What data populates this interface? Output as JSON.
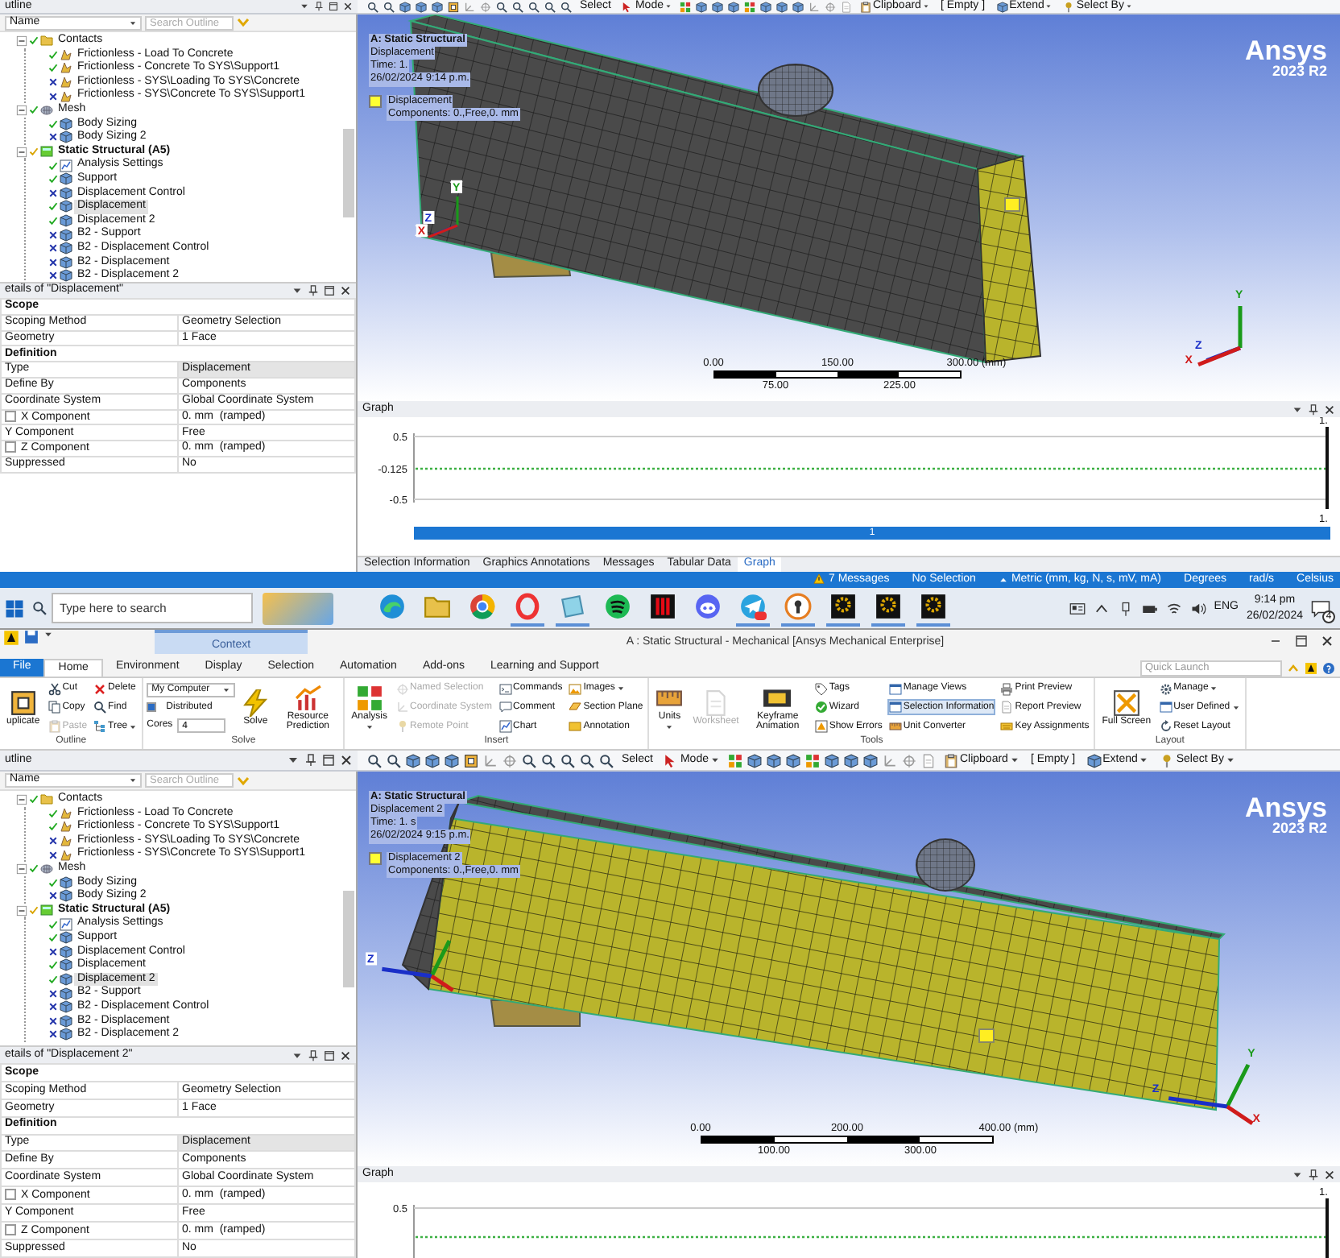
{
  "panes": [
    {
      "outline_title": "utline",
      "toolbar": [
        {
          "label": "Select",
          "kind": "button"
        },
        {
          "label": "Mode",
          "kind": "menu"
        },
        {
          "label": "Clipboard",
          "kind": "menu"
        },
        {
          "label": "[ Empty ]",
          "kind": "button"
        },
        {
          "label": "Extend",
          "kind": "menu"
        },
        {
          "label": "Select By",
          "kind": "menu"
        }
      ],
      "outline": {
        "name_filter": "Name",
        "search_placeholder": "Search Outline",
        "tree": [
          {
            "label": "Contacts",
            "kind": "folder",
            "solved": true,
            "suppressed": false,
            "selected": false,
            "expanded": true,
            "children": [
              {
                "label": "Frictionless - Load To Concrete",
                "kind": "contact",
                "solved": true,
                "suppressed": false,
                "selected": false
              },
              {
                "label": "Frictionless - Concrete To SYS\\Support1",
                "kind": "contact",
                "solved": true,
                "suppressed": false,
                "selected": false
              },
              {
                "label": "Frictionless - SYS\\Loading To SYS\\Concrete",
                "kind": "contact",
                "solved": false,
                "suppressed": true,
                "selected": false
              },
              {
                "label": "Frictionless - SYS\\Concrete To SYS\\Support1",
                "kind": "contact",
                "solved": false,
                "suppressed": true,
                "selected": false
              }
            ]
          },
          {
            "label": "Mesh",
            "kind": "mesh",
            "solved": true,
            "suppressed": false,
            "selected": false,
            "expanded": true,
            "children": [
              {
                "label": "Body Sizing",
                "kind": "sizing",
                "solved": true,
                "suppressed": false,
                "selected": false
              },
              {
                "label": "Body Sizing 2",
                "kind": "sizing",
                "solved": false,
                "suppressed": true,
                "selected": false
              }
            ]
          },
          {
            "label": "Static Structural (A5)",
            "kind": "environment",
            "solved": false,
            "suppressed": false,
            "selected": false,
            "expanded": true,
            "children": [
              {
                "label": "Analysis Settings",
                "kind": "settings",
                "solved": true,
                "suppressed": false,
                "selected": false
              },
              {
                "label": "Support",
                "kind": "boundary",
                "solved": true,
                "suppressed": false,
                "selected": false
              },
              {
                "label": "Displacement Control",
                "kind": "boundary",
                "solved": false,
                "suppressed": true,
                "selected": false
              },
              {
                "label": "Displacement",
                "kind": "boundary",
                "solved": true,
                "suppressed": false,
                "selected": true
              },
              {
                "label": "Displacement 2",
                "kind": "boundary",
                "solved": true,
                "suppressed": false,
                "selected": false
              },
              {
                "label": "B2 - Support",
                "kind": "boundary",
                "solved": false,
                "suppressed": true,
                "selected": false
              },
              {
                "label": "B2 - Displacement Control",
                "kind": "boundary",
                "solved": false,
                "suppressed": true,
                "selected": false
              },
              {
                "label": "B2 - Displacement",
                "kind": "boundary",
                "solved": false,
                "suppressed": true,
                "selected": false
              },
              {
                "label": "B2 - Displacement 2",
                "kind": "boundary",
                "solved": false,
                "suppressed": true,
                "selected": false
              }
            ]
          }
        ]
      },
      "details": {
        "title": "etails of \"Displacement\"",
        "rows": [
          {
            "kind": "section",
            "label": "Scope"
          },
          {
            "kind": "property",
            "label": "Scoping Method",
            "value": "Geometry Selection",
            "highlighted": false
          },
          {
            "kind": "property",
            "label": "Geometry",
            "value": "1 Face",
            "highlighted": false
          },
          {
            "kind": "section",
            "label": "Definition"
          },
          {
            "kind": "property",
            "label": "Type",
            "value": "Displacement",
            "highlighted": true
          },
          {
            "kind": "property",
            "label": "Define By",
            "value": "Components",
            "highlighted": false
          },
          {
            "kind": "property",
            "label": "Coordinate System",
            "value": "Global Coordinate System",
            "highlighted": false
          },
          {
            "kind": "check-property",
            "label": "X Component",
            "value": "0. mm  (ramped)",
            "checked": false,
            "highlighted": false
          },
          {
            "kind": "property",
            "label": "Y Component",
            "value": "Free",
            "highlighted": false
          },
          {
            "kind": "check-property",
            "label": "Z Component",
            "value": "0. mm  (ramped)",
            "checked": false,
            "highlighted": false
          },
          {
            "kind": "property",
            "label": "Suppressed",
            "value": "No",
            "highlighted": false
          }
        ]
      },
      "viewport": {
        "title": "A: Static Structural",
        "lines": [
          "Displacement",
          "Time: 1.",
          "26/02/2024 9:14 p.m."
        ],
        "legend": {
          "name": "Displacement",
          "detail": "Components: 0.,Free,0. mm"
        },
        "logo": "Ansys",
        "version": "2023 R2",
        "scale": {
          "top_labels": [
            "0.00",
            "150.00",
            "300.00 (mm)"
          ],
          "bottom_labels": [
            "75.00",
            "225.00"
          ]
        },
        "triad_labels": [
          {
            "text": "Y",
            "kind": "y"
          },
          {
            "text": "Z",
            "kind": "z"
          },
          {
            "text": "X",
            "kind": "x"
          }
        ],
        "origin_triad_labels": [
          {
            "text": "Y",
            "kind": "y"
          },
          {
            "text": "Z",
            "kind": "z"
          },
          {
            "text": "X",
            "kind": "x"
          }
        ]
      },
      "graph": {
        "title": "Graph",
        "y_tick_labels": [
          "0.5",
          "-0.125",
          "-0.5"
        ],
        "cursor_label": "1.",
        "end_label": "1.",
        "step_bar": "1"
      },
      "bottom_tabs": [
        {
          "label": "Selection Information",
          "selected": false
        },
        {
          "label": "Graphics Annotations",
          "selected": false
        },
        {
          "label": "Messages",
          "selected": false
        },
        {
          "label": "Tabular Data",
          "selected": false
        },
        {
          "label": "Graph",
          "selected": true
        }
      ],
      "status_bar": [
        {
          "text": "7 Messages",
          "kind": "messages"
        },
        {
          "text": "No Selection",
          "kind": "plain"
        },
        {
          "text": "Metric (mm, kg, N, s, mV, mA)",
          "kind": "menu"
        },
        {
          "text": "Degrees",
          "kind": "plain"
        },
        {
          "text": "rad/s",
          "kind": "plain"
        },
        {
          "text": "Celsius",
          "kind": "plain"
        }
      ],
      "taskbar": {
        "search_placeholder": "Type here to search",
        "apps": [
          {
            "kind": "edge",
            "running": false
          },
          {
            "kind": "folder",
            "running": false
          },
          {
            "kind": "chrome",
            "running": false
          },
          {
            "kind": "opera",
            "running": true
          },
          {
            "kind": "tile",
            "running": true
          },
          {
            "kind": "spotify",
            "running": false
          },
          {
            "kind": "netflix",
            "running": false
          },
          {
            "kind": "discord",
            "running": false
          },
          {
            "kind": "telegram",
            "running": true
          },
          {
            "kind": "keyhole",
            "running": true
          },
          {
            "kind": "gear",
            "running": true
          },
          {
            "kind": "gear",
            "running": true
          },
          {
            "kind": "gear",
            "running": true
          }
        ],
        "language": "ENG",
        "time": "9:14 pm",
        "date": "26/02/2024",
        "notification_count": "4"
      }
    },
    {
      "title_bar": {
        "context_label": "Context",
        "title": "A : Static Structural - Mechanical [Ansys Mechanical Enterprise]"
      },
      "ribbon": {
        "tabs": [
          {
            "label": "File",
            "kind": "file",
            "selected": false
          },
          {
            "label": "Home",
            "kind": "tab",
            "selected": true
          },
          {
            "label": "Environment",
            "kind": "tab",
            "selected": false
          },
          {
            "label": "Display",
            "kind": "tab",
            "selected": false
          },
          {
            "label": "Selection",
            "kind": "tab",
            "selected": false
          },
          {
            "label": "Automation",
            "kind": "tab",
            "selected": false
          },
          {
            "label": "Add-ons",
            "kind": "tab",
            "selected": false
          },
          {
            "label": "Learning and Support",
            "kind": "tab",
            "selected": false
          }
        ],
        "quick_launch_placeholder": "Quick Launch",
        "groups": [
          {
            "label": "Outline",
            "columns": [
              [
                {
                  "kind": "large",
                  "label": "uplicate",
                  "disabled": false,
                  "menu": false,
                  "selected": false
                }
              ],
              [
                {
                  "kind": "small",
                  "label": "Cut",
                  "disabled": false,
                  "menu": false,
                  "selected": false
                },
                {
                  "kind": "small",
                  "label": "Copy",
                  "disabled": false,
                  "menu": false,
                  "selected": false
                },
                {
                  "kind": "small",
                  "label": "Paste",
                  "disabled": true,
                  "menu": false,
                  "selected": false
                }
              ],
              [
                {
                  "kind": "small",
                  "label": "Delete",
                  "disabled": false,
                  "menu": false,
                  "selected": false
                },
                {
                  "kind": "small",
                  "label": "Find",
                  "disabled": false,
                  "menu": false,
                  "selected": false
                },
                {
                  "kind": "small",
                  "label": "Tree",
                  "disabled": false,
                  "menu": true,
                  "selected": false
                }
              ]
            ]
          },
          {
            "label": "Solve",
            "columns": [
              [
                {
                  "kind": "dropdown",
                  "value": "My Computer"
                },
                {
                  "kind": "checkbox",
                  "label": "Distributed",
                  "checked": true
                },
                {
                  "kind": "spin",
                  "label": "Cores",
                  "value": "4"
                }
              ],
              [
                {
                  "kind": "large",
                  "label": "Solve",
                  "disabled": false,
                  "menu": false,
                  "selected": false
                }
              ],
              [
                {
                  "kind": "large",
                  "label": "Resource Prediction",
                  "disabled": false,
                  "menu": false,
                  "selected": false
                }
              ]
            ]
          },
          {
            "label": "Insert",
            "columns": [
              [
                {
                  "kind": "large",
                  "label": "Analysis",
                  "disabled": false,
                  "menu": true,
                  "selected": false
                }
              ],
              [
                {
                  "kind": "small",
                  "label": "Named Selection",
                  "disabled": true,
                  "menu": false,
                  "selected": false
                },
                {
                  "kind": "small",
                  "label": "Coordinate System",
                  "disabled": true,
                  "menu": false,
                  "selected": false
                },
                {
                  "kind": "small",
                  "label": "Remote Point",
                  "disabled": true,
                  "menu": false,
                  "selected": false
                }
              ],
              [
                {
                  "kind": "small",
                  "label": "Commands",
                  "disabled": false,
                  "menu": false,
                  "selected": false
                },
                {
                  "kind": "small",
                  "label": "Comment",
                  "disabled": false,
                  "menu": false,
                  "selected": false
                },
                {
                  "kind": "small",
                  "label": "Chart",
                  "disabled": false,
                  "menu": false,
                  "selected": false
                }
              ],
              [
                {
                  "kind": "small",
                  "label": "Images",
                  "disabled": false,
                  "menu": true,
                  "selected": false
                },
                {
                  "kind": "small",
                  "label": "Section Plane",
                  "disabled": false,
                  "menu": false,
                  "selected": false
                },
                {
                  "kind": "small",
                  "label": "Annotation",
                  "disabled": false,
                  "menu": false,
                  "selected": false
                }
              ]
            ]
          },
          {
            "label": "Tools",
            "columns": [
              [
                {
                  "kind": "large",
                  "label": "Units",
                  "disabled": false,
                  "menu": true,
                  "selected": false
                }
              ],
              [
                {
                  "kind": "large",
                  "label": "Worksheet",
                  "disabled": true,
                  "menu": false,
                  "selected": false
                }
              ],
              [
                {
                  "kind": "large",
                  "label": "Keyframe Animation",
                  "disabled": false,
                  "menu": false,
                  "selected": false
                }
              ],
              [
                {
                  "kind": "small",
                  "label": "Tags",
                  "disabled": false,
                  "menu": false,
                  "selected": false
                },
                {
                  "kind": "small",
                  "label": "Wizard",
                  "disabled": false,
                  "menu": false,
                  "selected": false
                },
                {
                  "kind": "small",
                  "label": "Show Errors",
                  "disabled": false,
                  "menu": false,
                  "selected": false
                }
              ],
              [
                {
                  "kind": "small",
                  "label": "Manage Views",
                  "disabled": false,
                  "menu": false,
                  "selected": false
                },
                {
                  "kind": "small",
                  "label": "Selection Information",
                  "disabled": false,
                  "menu": false,
                  "selected": true
                },
                {
                  "kind": "small",
                  "label": "Unit Converter",
                  "disabled": false,
                  "menu": false,
                  "selected": false
                }
              ],
              [
                {
                  "kind": "small",
                  "label": "Print Preview",
                  "disabled": false,
                  "menu": false,
                  "selected": false
                },
                {
                  "kind": "small",
                  "label": "Report Preview",
                  "disabled": false,
                  "menu": false,
                  "selected": false
                },
                {
                  "kind": "small",
                  "label": "Key Assignments",
                  "disabled": false,
                  "menu": false,
                  "selected": false
                }
              ]
            ]
          },
          {
            "label": "Layout",
            "columns": [
              [
                {
                  "kind": "large",
                  "label": "Full Screen",
                  "disabled": false,
                  "menu": false,
                  "selected": false
                }
              ],
              [
                {
                  "kind": "small",
                  "label": "Manage",
                  "disabled": false,
                  "menu": true,
                  "selected": false
                },
                {
                  "kind": "small",
                  "label": "User Defined",
                  "disabled": false,
                  "menu": true,
                  "selected": false
                },
                {
                  "kind": "small",
                  "label": "Reset Layout",
                  "disabled": false,
                  "menu": false,
                  "selected": false
                }
              ]
            ]
          }
        ]
      },
      "outline_title": "utline",
      "toolbar": [
        {
          "label": "Select",
          "kind": "button"
        },
        {
          "label": "Mode",
          "kind": "menu"
        },
        {
          "label": "Clipboard",
          "kind": "menu"
        },
        {
          "label": "[ Empty ]",
          "kind": "button"
        },
        {
          "label": "Extend",
          "kind": "menu"
        },
        {
          "label": "Select By",
          "kind": "menu"
        }
      ],
      "outline": {
        "name_filter": "Name",
        "search_placeholder": "Search Outline",
        "tree": [
          {
            "label": "Contacts",
            "kind": "folder",
            "solved": true,
            "suppressed": false,
            "selected": false,
            "expanded": true,
            "children": [
              {
                "label": "Frictionless - Load To Concrete",
                "kind": "contact",
                "solved": true,
                "suppressed": false,
                "selected": false
              },
              {
                "label": "Frictionless - Concrete To SYS\\Support1",
                "kind": "contact",
                "solved": true,
                "suppressed": false,
                "selected": false
              },
              {
                "label": "Frictionless - SYS\\Loading To SYS\\Concrete",
                "kind": "contact",
                "solved": false,
                "suppressed": true,
                "selected": false
              },
              {
                "label": "Frictionless - SYS\\Concrete To SYS\\Support1",
                "kind": "contact",
                "solved": false,
                "suppressed": true,
                "selected": false
              }
            ]
          },
          {
            "label": "Mesh",
            "kind": "mesh",
            "solved": true,
            "suppressed": false,
            "selected": false,
            "expanded": true,
            "children": [
              {
                "label": "Body Sizing",
                "kind": "sizing",
                "solved": true,
                "suppressed": false,
                "selected": false
              },
              {
                "label": "Body Sizing 2",
                "kind": "sizing",
                "solved": false,
                "suppressed": true,
                "selected": false
              }
            ]
          },
          {
            "label": "Static Structural (A5)",
            "kind": "environment",
            "solved": false,
            "suppressed": false,
            "selected": false,
            "expanded": true,
            "children": [
              {
                "label": "Analysis Settings",
                "kind": "settings",
                "solved": true,
                "suppressed": false,
                "selected": false
              },
              {
                "label": "Support",
                "kind": "boundary",
                "solved": true,
                "suppressed": false,
                "selected": false
              },
              {
                "label": "Displacement Control",
                "kind": "boundary",
                "solved": false,
                "suppressed": true,
                "selected": false
              },
              {
                "label": "Displacement",
                "kind": "boundary",
                "solved": true,
                "suppressed": false,
                "selected": false
              },
              {
                "label": "Displacement 2",
                "kind": "boundary",
                "solved": true,
                "suppressed": false,
                "selected": true
              },
              {
                "label": "B2 - Support",
                "kind": "boundary",
                "solved": false,
                "suppressed": true,
                "selected": false
              },
              {
                "label": "B2 - Displacement Control",
                "kind": "boundary",
                "solved": false,
                "suppressed": true,
                "selected": false
              },
              {
                "label": "B2 - Displacement",
                "kind": "boundary",
                "solved": false,
                "suppressed": true,
                "selected": false
              },
              {
                "label": "B2 - Displacement 2",
                "kind": "boundary",
                "solved": false,
                "suppressed": true,
                "selected": false
              }
            ]
          }
        ]
      },
      "details": {
        "title": "etails of \"Displacement 2\"",
        "rows": [
          {
            "kind": "section",
            "label": "Scope"
          },
          {
            "kind": "property",
            "label": "Scoping Method",
            "value": "Geometry Selection",
            "highlighted": false
          },
          {
            "kind": "property",
            "label": "Geometry",
            "value": "1 Face",
            "highlighted": false
          },
          {
            "kind": "section",
            "label": "Definition"
          },
          {
            "kind": "property",
            "label": "Type",
            "value": "Displacement",
            "highlighted": true
          },
          {
            "kind": "property",
            "label": "Define By",
            "value": "Components",
            "highlighted": false
          },
          {
            "kind": "property",
            "label": "Coordinate System",
            "value": "Global Coordinate System",
            "highlighted": false
          },
          {
            "kind": "check-property",
            "label": "X Component",
            "value": "0. mm  (ramped)",
            "checked": false,
            "highlighted": false
          },
          {
            "kind": "property",
            "label": "Y Component",
            "value": "Free",
            "highlighted": false
          },
          {
            "kind": "check-property",
            "label": "Z Component",
            "value": "0. mm  (ramped)",
            "checked": false,
            "highlighted": false
          },
          {
            "kind": "property",
            "label": "Suppressed",
            "value": "No",
            "highlighted": false
          }
        ]
      },
      "viewport": {
        "title": "A: Static Structural",
        "lines": [
          "Displacement 2",
          "Time: 1. s",
          "26/02/2024 9:15 p.m."
        ],
        "legend": {
          "name": "Displacement 2",
          "detail": "Components: 0.,Free,0. mm"
        },
        "logo": "Ansys",
        "version": "2023 R2",
        "scale": {
          "top_labels": [
            "0.00",
            "200.00",
            "400.00 (mm)"
          ],
          "bottom_labels": [
            "100.00",
            "300.00"
          ]
        },
        "triad_labels": [
          {
            "text": "Y",
            "kind": "y"
          },
          {
            "text": "Z",
            "kind": "z"
          },
          {
            "text": "X",
            "kind": "x"
          }
        ],
        "origin_triad_labels": [
          {
            "text": "Z",
            "kind": "z"
          }
        ]
      },
      "graph": {
        "title": "Graph",
        "y_tick_labels": [
          "0.5"
        ],
        "cursor_label": "1."
      }
    }
  ]
}
